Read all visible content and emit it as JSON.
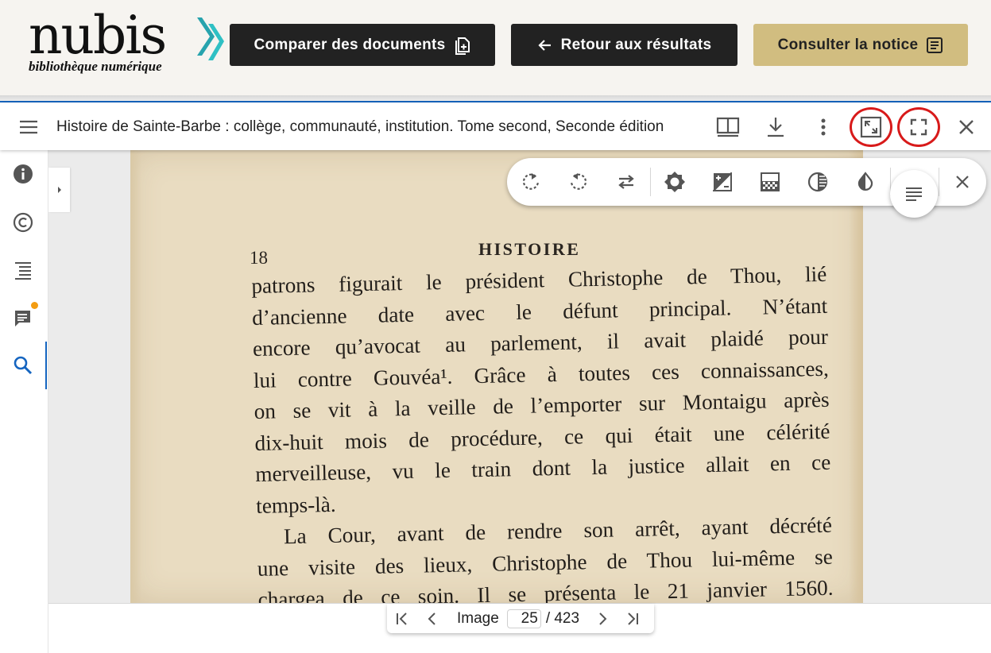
{
  "header": {
    "logo_word": "nubis",
    "logo_subtitle": "bibliothèque numérique",
    "compare_label": "Comparer des documents",
    "back_label": "Retour aux résultats",
    "notice_label": "Consulter la notice",
    "dark_button_color": "#222222",
    "gold_button_color": "#d1bd80",
    "logo_accent_color": "#2aa7a7"
  },
  "viewer": {
    "title": "Histoire de Sainte-Barbe : collège, communauté, institution. Tome second, Seconde édition",
    "toolbar_icons": [
      "two-page-view-icon",
      "download-icon",
      "more-vert-icon",
      "expand-view-icon",
      "fullscreen-icon",
      "close-icon"
    ],
    "highlight_color": "#d81a1a",
    "accent_color": "#1565c0"
  },
  "left_rail": {
    "items": [
      "info-icon",
      "copyright-icon",
      "table-of-contents-icon",
      "annotations-icon",
      "search-icon"
    ],
    "active_item": "search-icon",
    "notification_color": "#f39c12"
  },
  "image_tools": [
    "rotate-right-icon",
    "rotate-left-icon",
    "flip-icon",
    "brightness-icon",
    "contrast-icon",
    "saturation-icon",
    "grayscale-icon",
    "invert-colors-icon",
    "reset-icon",
    "close-icon"
  ],
  "page": {
    "number": "18",
    "heading": "HISTOIRE",
    "lines": [
      "patrons figurait le président Christophe de Thou, lié",
      "d’ancienne date avec le défunt principal. N’étant",
      "encore qu’avocat au parlement, il avait plaidé pour",
      "lui contre Gouvéa¹. Grâce à toutes ces connaissances,",
      "on se vit à la veille de l’emporter sur Montaigu après",
      "dix-huit mois de procédure, ce qui était une célérité",
      "merveilleuse, vu le train dont la justice allait en ce",
      "temps-là.",
      "La Cour, avant de rendre son arrêt, ayant décrété",
      "une visite des lieux, Christophe de Thou lui-même se",
      "chargea de ce soin. Il se présenta le 21 janvier 1560."
    ]
  },
  "pager": {
    "label": "Image",
    "current": "25",
    "total": "/ 423"
  }
}
